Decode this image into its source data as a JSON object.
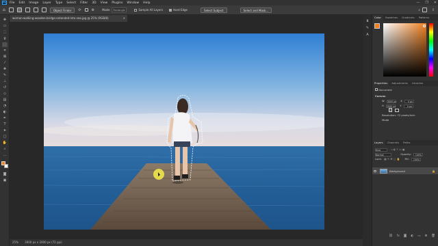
{
  "app": {
    "logo": "Ps"
  },
  "menu": [
    "File",
    "Edit",
    "Image",
    "Layer",
    "Type",
    "Select",
    "Filter",
    "3D",
    "View",
    "Plugins",
    "Window",
    "Help"
  ],
  "window_controls": [
    "—",
    "❐",
    "✕"
  ],
  "options_bar": {
    "new_selection_label": "Object Finder",
    "mode_label": "Mode:",
    "mode_value": "Rectangle",
    "sample_all_layers": "Sample All Layers",
    "hard_edge": "Hard Edge",
    "select_subject": "Select Subject",
    "select_and_mask": "Select and Mask..."
  },
  "document": {
    "tab_title": "woman-walking-wooden-bridge-extended-into-sea.jpg @ 25% (RGB/8)",
    "close": "×"
  },
  "status": {
    "zoom": "25%",
    "info": "3000 px x 2000 px (72 ppi)"
  },
  "color_panel": {
    "tabs": [
      "Color",
      "Swatches",
      "Gradients",
      "Patterns"
    ]
  },
  "properties_panel": {
    "tabs": [
      "Properties",
      "Adjustments",
      "Libraries"
    ],
    "doc_type": "Document",
    "section": "Canvas",
    "w_label": "W",
    "w_value": "3000 px",
    "h_label": "H",
    "h_value": "2000 px",
    "x_label": "X",
    "x_value": "0 px",
    "y_label": "Y",
    "y_value": "0 px",
    "resolution": "Resolution: 72 pixels/inch",
    "mode": "Mode"
  },
  "layers_panel": {
    "tabs": [
      "Layers",
      "Channels",
      "Paths"
    ],
    "kind": "Kind",
    "blend": "Normal",
    "opacity_label": "Opacity:",
    "opacity_value": "100%",
    "lock_label": "Lock:",
    "fill_label": "Fill:",
    "fill_value": "100%",
    "layer_name": "Background"
  },
  "colors": {
    "accent": "#31a8ff",
    "foreground_swatch": "#f08020",
    "background_swatch": "#ffffff"
  }
}
